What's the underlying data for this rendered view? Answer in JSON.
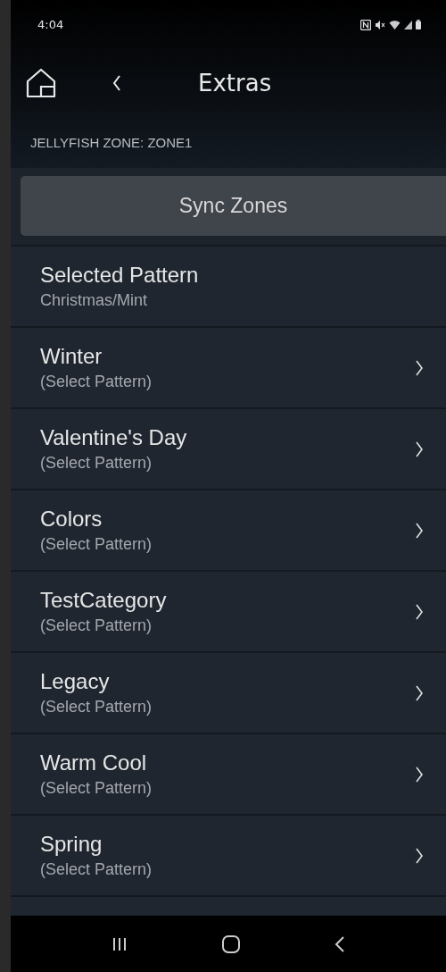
{
  "status_bar": {
    "time": "4:04"
  },
  "header": {
    "title": "Extras"
  },
  "zone_label": "JELLYFISH ZONE: ZONE1",
  "sync_button": "Sync Zones",
  "rows": [
    {
      "kind": "current",
      "title": "Selected Pattern",
      "subtitle": "Christmas/Mint"
    },
    {
      "kind": "category",
      "title": "Winter",
      "subtitle": "(Select Pattern)"
    },
    {
      "kind": "category",
      "title": "Valentine's Day",
      "subtitle": "(Select Pattern)"
    },
    {
      "kind": "category",
      "title": "Colors",
      "subtitle": "(Select Pattern)"
    },
    {
      "kind": "category",
      "title": "TestCategory",
      "subtitle": "(Select Pattern)"
    },
    {
      "kind": "category",
      "title": "Legacy",
      "subtitle": "(Select Pattern)"
    },
    {
      "kind": "category",
      "title": "Warm Cool",
      "subtitle": "(Select Pattern)"
    },
    {
      "kind": "category",
      "title": "Spring",
      "subtitle": "(Select Pattern)"
    }
  ]
}
